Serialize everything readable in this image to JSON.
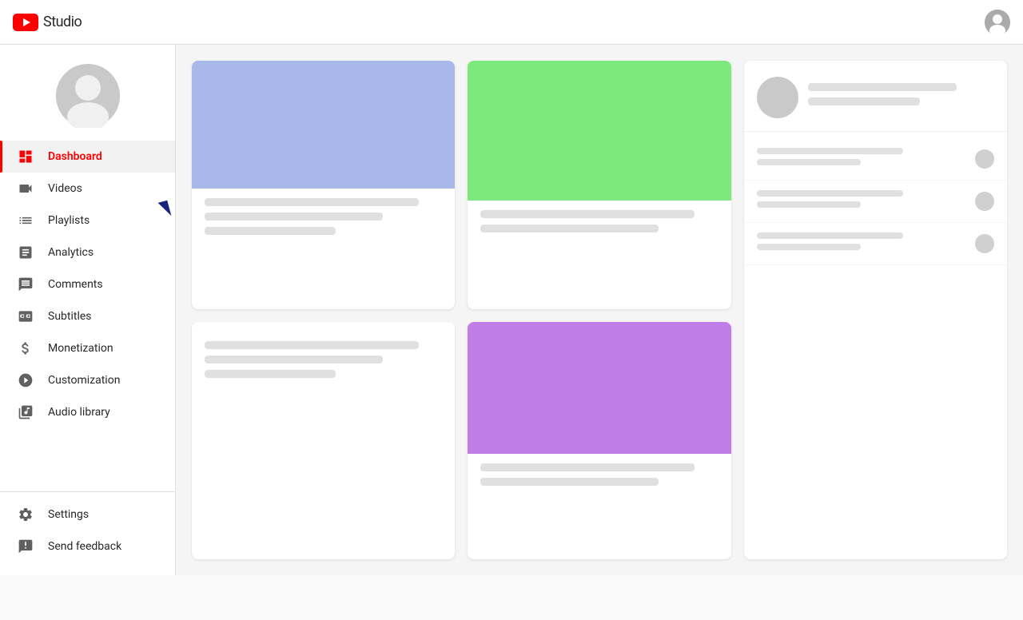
{
  "header": {
    "logo_text": "Studio",
    "title": "YouTube Studio"
  },
  "sidebar": {
    "nav_items": [
      {
        "id": "dashboard",
        "label": "Dashboard",
        "icon": "dashboard-icon",
        "active": true
      },
      {
        "id": "videos",
        "label": "Videos",
        "icon": "videos-icon",
        "active": false
      },
      {
        "id": "playlists",
        "label": "Playlists",
        "icon": "playlists-icon",
        "active": false
      },
      {
        "id": "analytics",
        "label": "Analytics",
        "icon": "analytics-icon",
        "active": false
      },
      {
        "id": "comments",
        "label": "Comments",
        "icon": "comments-icon",
        "active": false
      },
      {
        "id": "subtitles",
        "label": "Subtitles",
        "icon": "subtitles-icon",
        "active": false
      },
      {
        "id": "monetization",
        "label": "Monetization",
        "icon": "monetization-icon",
        "active": false
      },
      {
        "id": "customization",
        "label": "Customization",
        "icon": "customization-icon",
        "active": false
      },
      {
        "id": "audio-library",
        "label": "Audio library",
        "icon": "audio-library-icon",
        "active": false
      }
    ],
    "bottom_items": [
      {
        "id": "settings",
        "label": "Settings",
        "icon": "settings-icon"
      },
      {
        "id": "send-feedback",
        "label": "Send feedback",
        "icon": "feedback-icon"
      }
    ]
  },
  "colors": {
    "accent": "#ff0000",
    "active_bg": "#f2f2f2",
    "card_thumb_blue": "#a8b8e8",
    "card_thumb_green": "#7de87d",
    "card_thumb_purple": "#c07de8"
  }
}
